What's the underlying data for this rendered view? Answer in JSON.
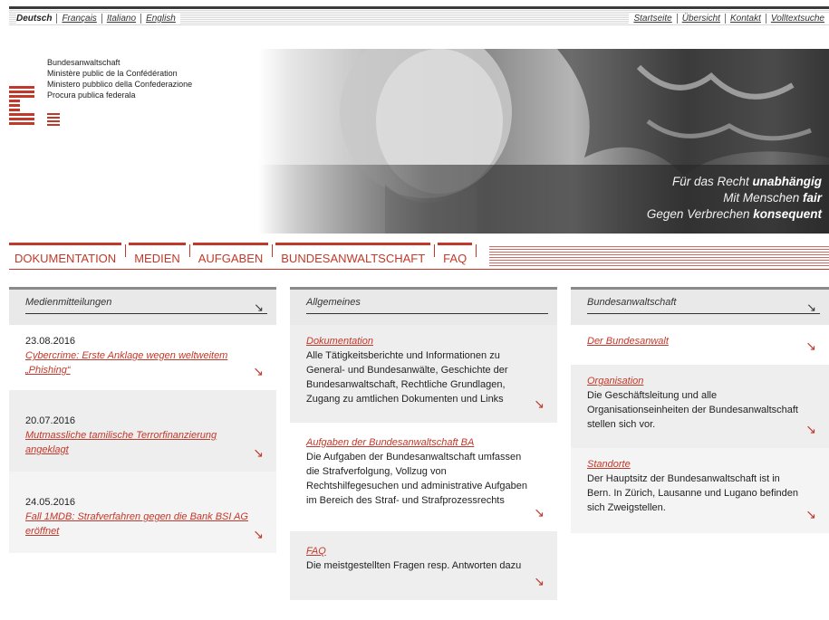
{
  "languages": [
    "Deutsch",
    "Français",
    "Italiano",
    "English"
  ],
  "service_nav": [
    "Startseite",
    "Übersicht",
    "Kontakt",
    "Volltextsuche"
  ],
  "logo": {
    "lines": [
      "Bundesanwaltschaft",
      "Ministère public de la Confédération",
      "Ministero pubblico della Confederazione",
      "Procura publica federala"
    ]
  },
  "slogan": {
    "line1_pre": "Für das Recht ",
    "line1_bold": "unabhängig",
    "line2_pre": "Mit Menschen ",
    "line2_bold": "fair",
    "line3_pre": "Gegen Verbrechen ",
    "line3_bold": "konsequent"
  },
  "main_nav": [
    "DOKUMENTATION",
    "MEDIEN",
    "AUFGABEN",
    "BUNDESANWALTSCHAFT",
    "FAQ"
  ],
  "columns": {
    "media": {
      "title": "Medienmitteilungen",
      "items": [
        {
          "date": "23.08.2016",
          "link": "Cybercrime: Erste Anklage wegen weltweitem „Phishing“"
        },
        {
          "date": "20.07.2016",
          "link": "Mutmassliche tamilische Terrorfinanzierung angeklagt"
        },
        {
          "date": "24.05.2016",
          "link": "Fall 1MDB: Strafverfahren gegen die Bank BSI AG eröffnet"
        }
      ]
    },
    "general": {
      "title": "Allgemeines",
      "items": [
        {
          "link": "Dokumentation",
          "desc": "Alle Tätigkeitsberichte und Informationen zu General- und Bundesanwälte, Geschichte der Bundesanwaltschaft, Rechtliche Grundlagen, Zugang zu amtlichen Dokumenten und Links"
        },
        {
          "link": "Aufgaben der Bundesanwaltschaft BA",
          "desc": "Die Aufgaben der Bundesanwaltschaft umfassen die Strafverfolgung, Vollzug von Rechtshilfegesuchen und administrative Aufgaben im Bereich des Straf- und Strafprozessrechts"
        },
        {
          "link": "FAQ",
          "desc": "Die meistgestellten Fragen resp. Antworten dazu"
        }
      ]
    },
    "oag": {
      "title": "Bundesanwaltschaft",
      "items": [
        {
          "link": "Der Bundesanwalt",
          "desc": ""
        },
        {
          "link": "Organisation",
          "desc": "Die Geschäftsleitung und alle Organisationseinheiten der Bundesanwaltschaft stellen sich vor."
        },
        {
          "link": "Standorte",
          "desc": "Der Hauptsitz der Bundesanwaltschaft ist in Bern. In Zürich, Lausanne und Lugano befinden sich Zweigstellen."
        }
      ]
    }
  },
  "colors": {
    "accent": "#c0392b",
    "panel_gray": "#eeeeee"
  }
}
